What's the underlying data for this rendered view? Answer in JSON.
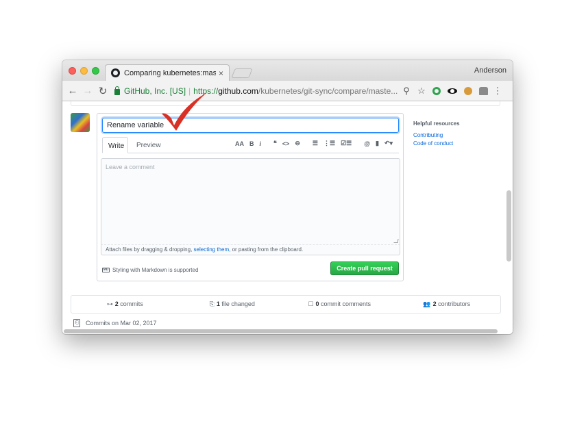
{
  "browser": {
    "tab_title": "Comparing kubernetes:master",
    "tab_close": "×",
    "profile": "Anderson",
    "back": "←",
    "forward": "→",
    "reload": "↻",
    "ev_name": "GitHub, Inc. [US]",
    "url_scheme": "https://",
    "url_host": "github.com",
    "url_path": "/kubernetes/git-sync/compare/maste...",
    "zoom_icon": "⚲",
    "star_icon": "☆",
    "menu": "⋮"
  },
  "pr_form": {
    "title_value": "Rename variable",
    "tab_write": "Write",
    "tab_preview": "Preview",
    "toolbar": {
      "header": "AA",
      "bold": "B",
      "italic": "i",
      "quote": "❝",
      "code": "<>",
      "link": "⊖",
      "ul": "☰",
      "ol": "⋮☰",
      "tasks": "☑☰",
      "mention": "@",
      "bookmark": "▮",
      "reply": "↶▾"
    },
    "comment_placeholder": "Leave a comment",
    "attach_pre": "Attach files by dragging & dropping, ",
    "attach_link": "selecting them",
    "attach_post": ", or pasting from the clipboard.",
    "markdown_badge": "MD",
    "markdown_note": "Styling with Markdown is supported",
    "submit_label": "Create pull request"
  },
  "sidebar": {
    "heading": "Helpful resources",
    "links": [
      "Contributing",
      "Code of conduct"
    ]
  },
  "stats": {
    "commits_icon": "⊶",
    "commits_count": "2",
    "commits_label": " commits",
    "files_icon": "⎘",
    "files_count": "1",
    "files_label": " file changed",
    "comments_icon": "☐",
    "comments_count": "0",
    "comments_label": " commit comments",
    "contrib_icon": "👥",
    "contrib_count": "2",
    "contrib_label": " contributors"
  },
  "commits_heading": "Commits on Mar 02, 2017",
  "commit_icon": "⎗",
  "colors": {
    "accent_blue": "#0366d6",
    "create_green": "#28a745",
    "annotation_red": "#d93025"
  },
  "annotation": "red-checkmark"
}
